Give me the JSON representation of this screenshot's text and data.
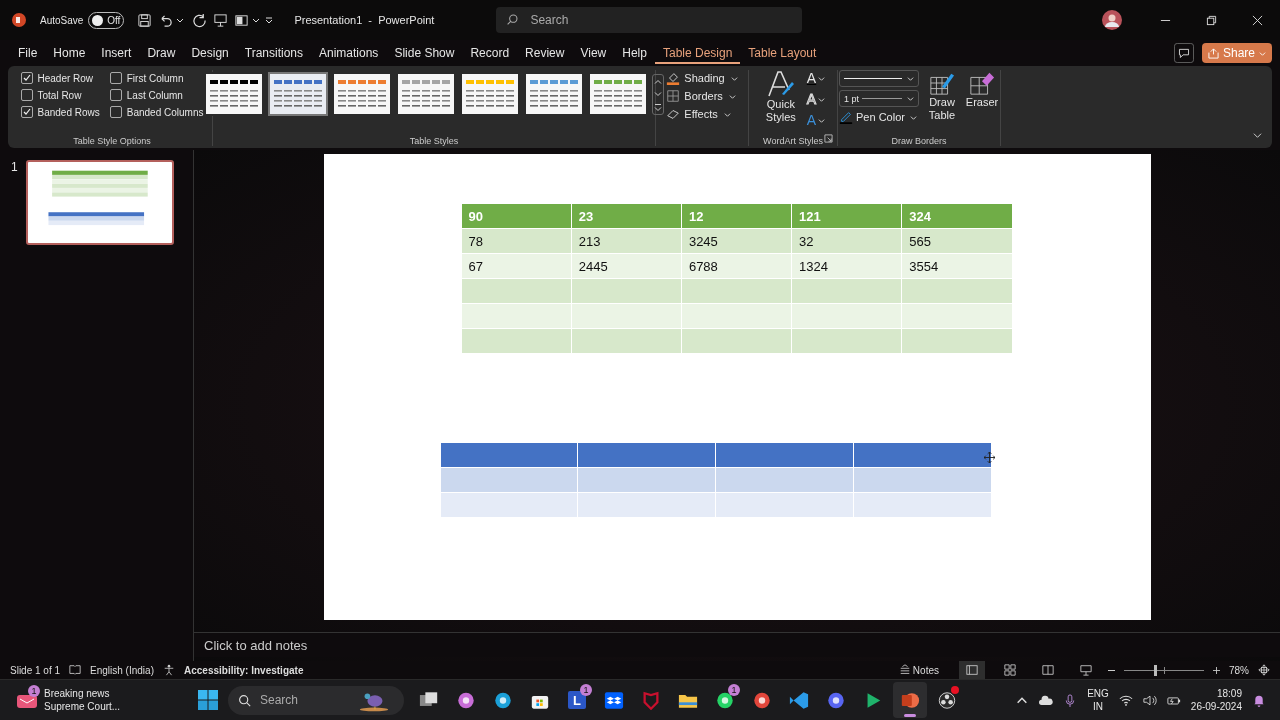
{
  "title_bar": {
    "autosave_label": "AutoSave",
    "autosave": {
      "label": "Off",
      "on": false
    },
    "title": "Presentation1  -  PowerPoint",
    "search": {
      "placeholder": "Search"
    }
  },
  "menu": {
    "tabs": [
      {
        "label": "File",
        "selected": false,
        "kind": "standard"
      },
      {
        "label": "Home",
        "selected": false,
        "kind": "standard"
      },
      {
        "label": "Insert",
        "selected": false,
        "kind": "standard"
      },
      {
        "label": "Draw",
        "selected": false,
        "kind": "standard"
      },
      {
        "label": "Design",
        "selected": false,
        "kind": "standard"
      },
      {
        "label": "Transitions",
        "selected": false,
        "kind": "standard"
      },
      {
        "label": "Animations",
        "selected": false,
        "kind": "standard"
      },
      {
        "label": "Slide Show",
        "selected": false,
        "kind": "standard"
      },
      {
        "label": "Record",
        "selected": false,
        "kind": "standard"
      },
      {
        "label": "Review",
        "selected": false,
        "kind": "standard"
      },
      {
        "label": "View",
        "selected": false,
        "kind": "standard"
      },
      {
        "label": "Help",
        "selected": false,
        "kind": "standard"
      },
      {
        "label": "Table Design",
        "selected": true,
        "kind": "contextual"
      },
      {
        "label": "Table Layout",
        "selected": false,
        "kind": "contextual"
      }
    ],
    "share": "Share"
  },
  "ribbon": {
    "table_style_options": {
      "label": "Table Style Options",
      "options": [
        {
          "label": "Header Row",
          "checked": true
        },
        {
          "label": "First Column",
          "checked": false
        },
        {
          "label": "Total Row",
          "checked": false
        },
        {
          "label": "Last Column",
          "checked": false
        },
        {
          "label": "Banded Rows",
          "checked": true
        },
        {
          "label": "Banded Columns",
          "checked": false
        }
      ]
    },
    "table_styles": {
      "label": "Table Styles",
      "styles": [
        {
          "color": "#000000",
          "selected": false
        },
        {
          "color": "#4472c4",
          "selected": true
        },
        {
          "color": "#ed7d31",
          "selected": false
        },
        {
          "color": "#a5a5a5",
          "selected": false
        },
        {
          "color": "#ffc000",
          "selected": false
        },
        {
          "color": "#5b9bd5",
          "selected": false
        },
        {
          "color": "#70ad47",
          "selected": false
        }
      ]
    },
    "style_commands": [
      {
        "label": "Shading",
        "kind": "shading"
      },
      {
        "label": "Borders",
        "kind": "borders"
      },
      {
        "label": "Effects",
        "kind": "effects"
      }
    ],
    "wordart": {
      "label": "WordArt Styles",
      "quick_styles": "Quick Styles",
      "text_buttons": [
        {
          "label": "A",
          "kind": "fill"
        },
        {
          "label": "A",
          "kind": "outline"
        },
        {
          "label": "A",
          "kind": "effects"
        }
      ]
    },
    "draw_borders": {
      "label": "Draw Borders",
      "pen_weight": "1 pt",
      "pen_color": "Pen Color",
      "tools": [
        {
          "label": "Draw Table",
          "kind": "draw"
        },
        {
          "label": "Eraser",
          "kind": "eraser"
        }
      ]
    }
  },
  "slides_panel": {
    "slides": [
      {
        "number": "1",
        "selected": true
      }
    ]
  },
  "slide": {
    "tables": [
      {
        "color": "#70ad47",
        "columns": [
          "90",
          "23",
          "12",
          "121",
          "324"
        ],
        "rows": [
          {
            "kind": "data",
            "cells": [
              "78",
              "213",
              "3245",
              "32",
              "565"
            ]
          },
          {
            "kind": "data",
            "cells": [
              "67",
              "2445",
              "6788",
              "1324",
              "3554"
            ]
          },
          {
            "kind": "blank"
          },
          {
            "kind": "blank"
          },
          {
            "kind": "blank"
          }
        ]
      },
      {
        "color": "#4472c4",
        "columns": [
          {
            "kind": "blank"
          },
          {
            "kind": "blank"
          },
          {
            "kind": "blank"
          },
          {
            "kind": "blank"
          }
        ],
        "rows": [
          {
            "kind": "blank"
          },
          {
            "kind": "blank"
          }
        ]
      }
    ]
  },
  "notes": {
    "placeholder": "Click to add notes"
  },
  "status_bar": {
    "slide": "Slide 1 of 1",
    "language": "English (India)",
    "accessibility": "Accessibility: Investigate",
    "notes": "Notes",
    "views": [
      {
        "kind": "normal",
        "selected": true
      },
      {
        "kind": "sorter",
        "selected": false
      },
      {
        "kind": "reading",
        "selected": false
      },
      {
        "kind": "show",
        "selected": false
      }
    ],
    "zoom": {
      "level": 0.38
    },
    "zoom_label": "78%"
  },
  "taskbar": {
    "news": {
      "title": "Breaking news",
      "subtitle": "Supreme Court...",
      "badge": "1"
    },
    "search": {
      "placeholder": "Search"
    },
    "apps": [
      {
        "kind": "task-view",
        "selected": false,
        "alert": false
      },
      {
        "kind": "copilot",
        "selected": false,
        "alert": false
      },
      {
        "kind": "edge",
        "selected": false,
        "alert": false
      },
      {
        "kind": "store",
        "selected": false,
        "alert": false
      },
      {
        "kind": "letter",
        "label": "L",
        "badge": "1",
        "selected": false,
        "alert": false
      },
      {
        "kind": "dropbox",
        "selected": false,
        "alert": false
      },
      {
        "kind": "shield",
        "selected": false,
        "alert": false
      },
      {
        "kind": "folder",
        "selected": false,
        "alert": false
      },
      {
        "kind": "chat",
        "badge": "1",
        "selected": false,
        "alert": false
      },
      {
        "kind": "chrome",
        "selected": false,
        "alert": false
      },
      {
        "kind": "vscode",
        "selected": false,
        "alert": false
      },
      {
        "kind": "discord",
        "selected": false,
        "alert": false
      },
      {
        "kind": "play",
        "selected": false,
        "alert": false
      },
      {
        "kind": "powerpoint",
        "selected": true,
        "alert": false
      },
      {
        "kind": "obs",
        "selected": false,
        "alert": true
      }
    ],
    "tray": {
      "language": "ENG",
      "region": "IN",
      "time": "18:09",
      "date": "26-09-2024"
    }
  }
}
